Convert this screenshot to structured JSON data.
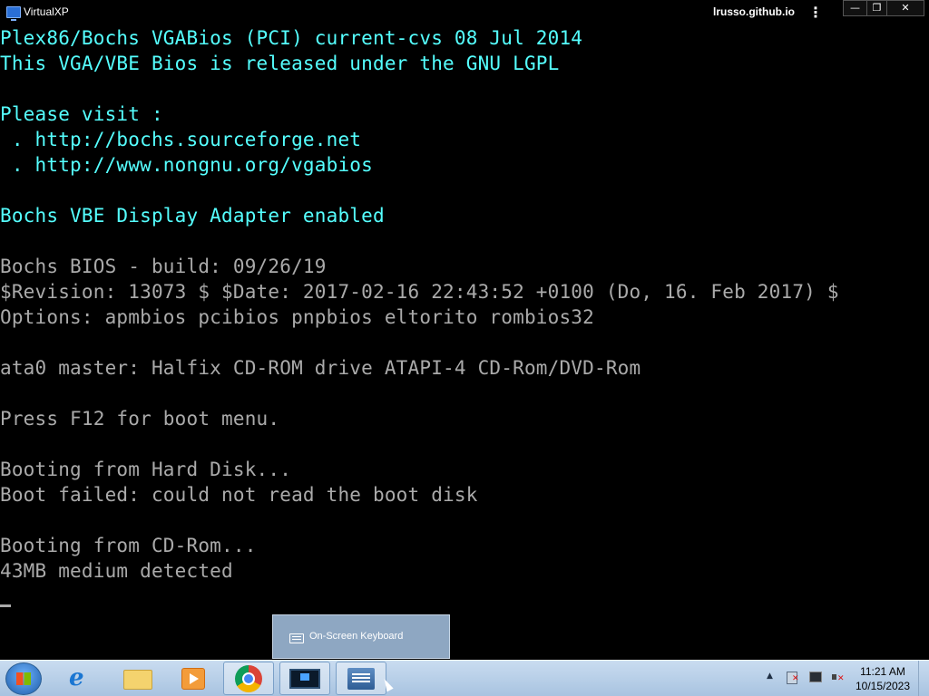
{
  "window": {
    "title": "VirtualXP",
    "host": "lrusso.github.io",
    "menu_glyph": "⋮",
    "controls": {
      "minimize": "—",
      "maximize": "❐",
      "close": "✕"
    }
  },
  "console": {
    "colors": {
      "cyan": "#55ffff",
      "gray": "#aaaaaa",
      "background": "#000000"
    },
    "lines": [
      {
        "text": "Plex86/Bochs VGABios (PCI) current-cvs 08 Jul 2014",
        "color": "cyan"
      },
      {
        "text": "This VGA/VBE Bios is released under the GNU LGPL",
        "color": "cyan"
      },
      {
        "text": "",
        "color": "cyan"
      },
      {
        "text": "Please visit :",
        "color": "cyan"
      },
      {
        "text": " . http://bochs.sourceforge.net",
        "color": "cyan"
      },
      {
        "text": " . http://www.nongnu.org/vgabios",
        "color": "cyan"
      },
      {
        "text": "",
        "color": "cyan"
      },
      {
        "text": "Bochs VBE Display Adapter enabled",
        "color": "cyan"
      },
      {
        "text": "",
        "color": "gray"
      },
      {
        "text": "Bochs BIOS - build: 09/26/19",
        "color": "gray"
      },
      {
        "text": "$Revision: 13073 $ $Date: 2017-02-16 22:43:52 +0100 (Do, 16. Feb 2017) $",
        "color": "gray"
      },
      {
        "text": "Options: apmbios pcibios pnpbios eltorito rombios32",
        "color": "gray"
      },
      {
        "text": "",
        "color": "gray"
      },
      {
        "text": "ata0 master: Halfix CD-ROM drive ATAPI-4 CD-Rom/DVD-Rom",
        "color": "gray"
      },
      {
        "text": "",
        "color": "gray"
      },
      {
        "text": "Press F12 for boot menu.",
        "color": "gray"
      },
      {
        "text": "",
        "color": "gray"
      },
      {
        "text": "Booting from Hard Disk...",
        "color": "gray"
      },
      {
        "text": "Boot failed: could not read the boot disk",
        "color": "gray"
      },
      {
        "text": "",
        "color": "gray"
      },
      {
        "text": "Booting from CD-Rom...",
        "color": "gray"
      },
      {
        "text": "43MB medium detected",
        "color": "gray"
      }
    ]
  },
  "tooltip": {
    "label": "On-Screen Keyboard",
    "icon": "keyboard-icon"
  },
  "taskbar": {
    "items": [
      {
        "name": "start-button",
        "icon": "windows-logo-icon"
      },
      {
        "name": "internet-explorer",
        "icon": "internet-explorer-icon",
        "glyph": "e"
      },
      {
        "name": "file-explorer",
        "icon": "folder-icon"
      },
      {
        "name": "media-player",
        "icon": "media-player-icon"
      },
      {
        "name": "chrome",
        "icon": "chrome-icon",
        "active": true
      },
      {
        "name": "virtualxp",
        "icon": "virtualxp-icon",
        "active": true
      },
      {
        "name": "on-screen-keyboard",
        "icon": "keyboard-icon",
        "active": true
      }
    ],
    "tray": {
      "arrow": "▲",
      "icons": [
        "action-center-flag-icon",
        "network-icon",
        "volume-muted-icon"
      ],
      "time": "11:21 AM",
      "date": "10/15/2023"
    }
  }
}
